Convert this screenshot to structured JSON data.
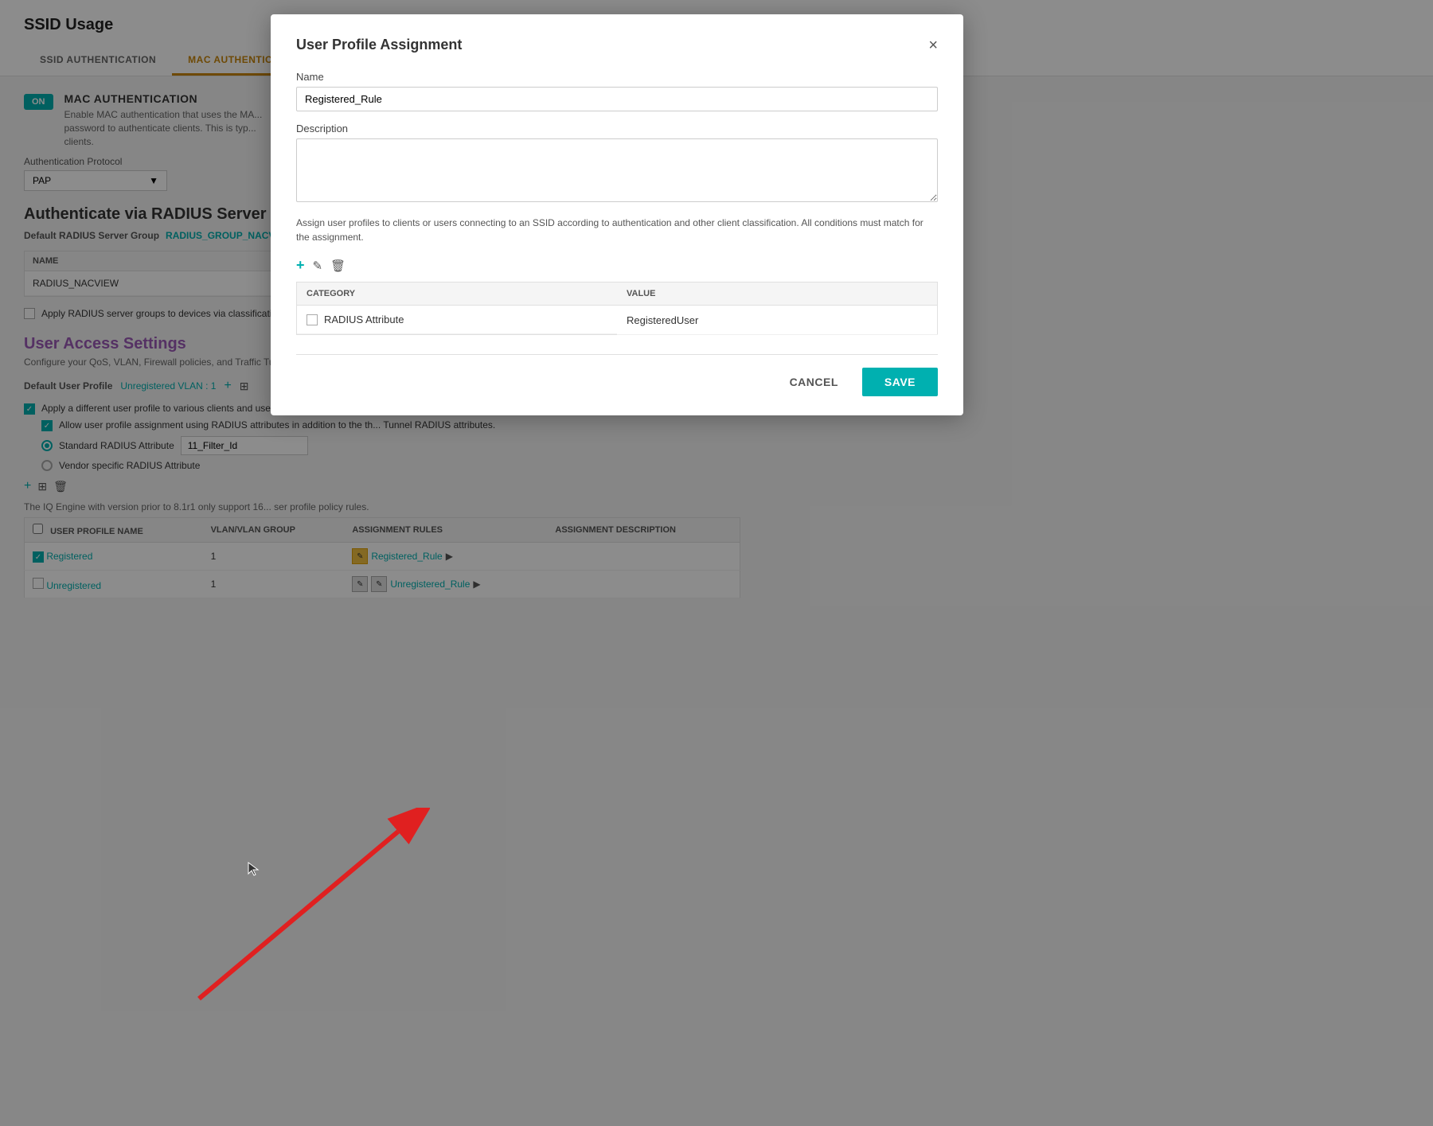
{
  "page": {
    "title": "SSID Usage",
    "tabs": [
      {
        "label": "SSID AUTHENTICATION",
        "active": false
      },
      {
        "label": "MAC AUTHENTICATION",
        "active": true
      }
    ]
  },
  "mac_auth": {
    "section_title": "MAC AUTHENTICATION",
    "toggle_label": "ON",
    "description": "Enable MAC authentication that uses the MA... password to authenticate clients. This is typ... clients.",
    "protocol_label": "Authentication Protocol",
    "protocol_value": "PAP"
  },
  "radius_section": {
    "title": "Authenticate via RADIUS Server",
    "default_label": "Default RADIUS Server Group",
    "default_link": "RADIUS_GROUP_NACVIE",
    "table_headers": [
      "Name",
      ""
    ],
    "table_rows": [
      {
        "name": "RADIUS_NACVIEW"
      }
    ],
    "apply_text": "Apply RADIUS server groups to devices via classification"
  },
  "user_access": {
    "title": "User Access Settings",
    "description": "Configure your QoS, VLAN, Firewall policies, and Traffic Tunnel...",
    "default_profile_label": "Default User Profile",
    "default_profile_link": "Unregistered VLAN : 1",
    "check1": "Apply a different user profile to various clients and user groups.",
    "check2": "Allow user profile assignment using RADIUS attributes in addition to the th... Tunnel RADIUS attributes.",
    "radio1": "Standard RADIUS Attribute",
    "radio1_value": "11_Filter_Id",
    "radio2": "Vendor specific RADIUS Attribute",
    "notice": "The IQ Engine with version prior to 8.1r1 only support 16... ser profile policy rules.",
    "table_headers": [
      "USER PROFILE NAME",
      "VLAN/VLAN GROUP",
      "ASSIGNMENT RULES",
      "ASSIGNMENT DESCRIPTION"
    ],
    "table_rows": [
      {
        "name": "Registered",
        "vlan": "1",
        "rule_label": "Registered_Rule",
        "description": ""
      },
      {
        "name": "Unregistered",
        "vlan": "1",
        "rule_label": "Unregistered_Rule",
        "description": ""
      }
    ]
  },
  "modal": {
    "title": "User Profile Assignment",
    "close_label": "×",
    "name_label": "Name",
    "name_value": "Registered_Rule",
    "description_label": "Description",
    "description_value": "",
    "info_text": "Assign user profiles to clients or users connecting to an SSID according to authentication and other client classification. All conditions must match for the assignment.",
    "table_headers": [
      "CATEGORY",
      "VALUE"
    ],
    "table_rows": [
      {
        "category": "RADIUS Attribute",
        "value": "RegisteredUser"
      }
    ],
    "cancel_label": "CANCEL",
    "save_label": "SAVE"
  }
}
